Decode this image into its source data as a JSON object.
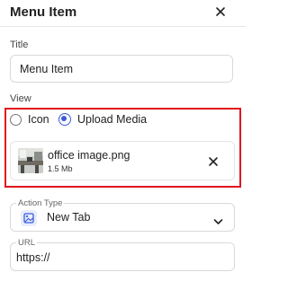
{
  "header": {
    "title": "Menu Item"
  },
  "title_field": {
    "label": "Title",
    "value": "Menu Item"
  },
  "view": {
    "label": "View",
    "options": [
      {
        "label": "Icon",
        "selected": false
      },
      {
        "label": "Upload Media",
        "selected": true
      }
    ]
  },
  "media": {
    "file_name": "office image.png",
    "file_size": "1.5 Mb"
  },
  "action_type": {
    "label": "Action Type",
    "value": "New Tab",
    "icon": "image-icon"
  },
  "url_field": {
    "label": "URL",
    "value": "https://"
  },
  "colors": {
    "accent": "#3b5bdb",
    "highlight_border": "#e0161e"
  }
}
